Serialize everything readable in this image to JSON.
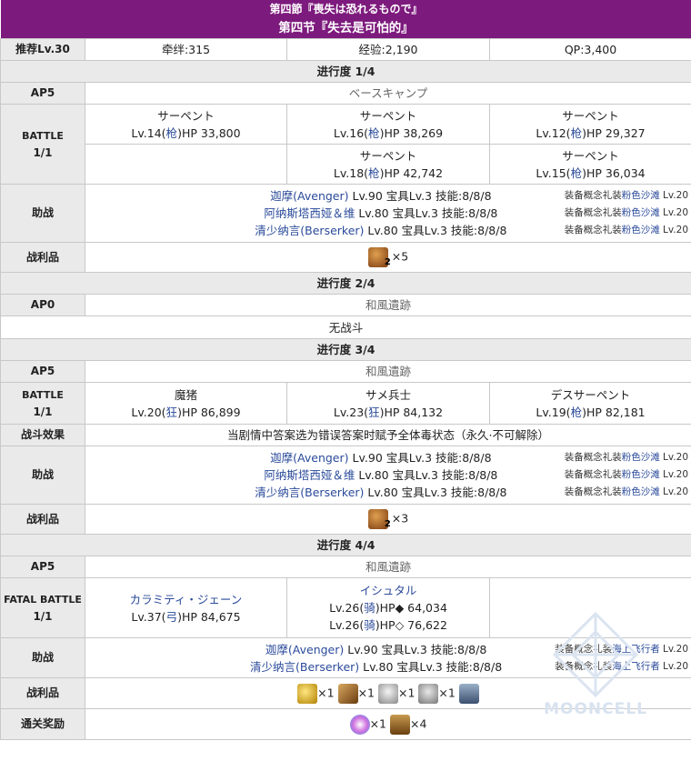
{
  "header": {
    "title_jp": "第四節『喪失は恐れるもので』",
    "title_cn": "第四节『失去是可怕的』"
  },
  "summary": {
    "recommend_label": "推荐Lv.30",
    "bond": "牵绊:315",
    "exp": "经验:2,190",
    "qp": "QP:3,400"
  },
  "progress1": {
    "title": "进行度 1/4",
    "ap": "AP5",
    "location": "ベースキャンプ",
    "battle_label": "BATTLE",
    "battle_count": "1/1",
    "enemies": [
      {
        "name": "サーペント",
        "pre": "Lv.14(",
        "cls": "枪",
        "post": ")HP 33,800"
      },
      {
        "name": "サーペント",
        "pre": "Lv.16(",
        "cls": "枪",
        "post": ")HP 38,269"
      },
      {
        "name": "サーペント",
        "pre": "Lv.12(",
        "cls": "枪",
        "post": ")HP 29,327"
      },
      {
        "name": "サーペント",
        "pre": "Lv.18(",
        "cls": "枪",
        "post": ")HP 42,742"
      },
      {
        "name": "サーペント",
        "pre": "Lv.15(",
        "cls": "枪",
        "post": ")HP 36,034"
      }
    ],
    "support_label": "助战",
    "supports": [
      {
        "name": "迦摩(Avenger)",
        "rest": " Lv.90 宝具Lv.3 技能:8/8/8",
        "ce_pre": "装备概念礼装",
        "ce": "粉色沙滩",
        "ce_lv": " Lv.20"
      },
      {
        "name": "阿纳斯塔西娅＆维",
        "rest": " Lv.80 宝具Lv.3 技能:8/8/8",
        "ce_pre": "装备概念礼装",
        "ce": "粉色沙滩",
        "ce_lv": " Lv.20"
      },
      {
        "name": "清少纳言(Berserker)",
        "rest": " Lv.80 宝具Lv.3 技能:8/8/8",
        "ce_pre": "装备概念礼装",
        "ce": "粉色沙滩",
        "ce_lv": " Lv.20"
      }
    ],
    "drops_label": "战利品",
    "drop_icon": "barrel-icon",
    "drop_sub": "2",
    "drop_count": "×5"
  },
  "progress2": {
    "title": "进行度 2/4",
    "ap": "AP0",
    "location": "和風遺跡",
    "no_battle": "无战斗"
  },
  "progress3": {
    "title": "进行度 3/4",
    "ap": "AP5",
    "location": "和風遺跡",
    "battle_label": "BATTLE",
    "battle_count": "1/1",
    "enemies": [
      {
        "name": "魔猪",
        "pre": "Lv.20(",
        "cls": "狂",
        "post": ")HP 86,899"
      },
      {
        "name": "サメ兵士",
        "pre": "Lv.23(",
        "cls": "狂",
        "post": ")HP 84,132"
      },
      {
        "name": "デスサーペント",
        "pre": "Lv.19(",
        "cls": "枪",
        "post": ")HP 82,181"
      }
    ],
    "effect_label": "战斗效果",
    "effect_text": "当剧情中答案选为错误答案时赋予全体毒状态（永久·不可解除）",
    "support_label": "助战",
    "supports": [
      {
        "name": "迦摩(Avenger)",
        "rest": " Lv.90 宝具Lv.3 技能:8/8/8",
        "ce_pre": "装备概念礼装",
        "ce": "粉色沙滩",
        "ce_lv": " Lv.20"
      },
      {
        "name": "阿纳斯塔西娅＆维",
        "rest": " Lv.80 宝具Lv.3 技能:8/8/8",
        "ce_pre": "装备概念礼装",
        "ce": "粉色沙滩",
        "ce_lv": " Lv.20"
      },
      {
        "name": "清少纳言(Berserker)",
        "rest": " Lv.80 宝具Lv.3 技能:8/8/8",
        "ce_pre": "装备概念礼装",
        "ce": "粉色沙滩",
        "ce_lv": " Lv.20"
      }
    ],
    "drops_label": "战利品",
    "drop_icon": "barrel-icon",
    "drop_sub": "2",
    "drop_count": "×3"
  },
  "progress4": {
    "title": "进行度 4/4",
    "ap": "AP5",
    "location": "和風遺跡",
    "battle_label": "FATAL BATTLE",
    "battle_count": "1/1",
    "enemy1": {
      "name": "カラミティ・ジェーン",
      "pre": "Lv.37(",
      "cls": "弓",
      "post": ")HP 84,675"
    },
    "enemy2": {
      "name": "イシュタル",
      "line1_pre": "Lv.26(",
      "line1_cls": "骑",
      "line1_post": ")HP◆ 64,034",
      "line2_pre": "Lv.26(",
      "line2_cls": "骑",
      "line2_post": ")HP◇ 76,622"
    },
    "support_label": "助战",
    "supports": [
      {
        "name": "迦摩(Avenger)",
        "rest": " Lv.90 宝具Lv.3 技能:8/8/8",
        "ce_pre": "装备概念礼装",
        "ce": "海上飞行者",
        "ce_lv": " Lv.20"
      },
      {
        "name": "清少纳言(Berserker)",
        "rest": " Lv.80 宝具Lv.3 技能:8/8/8",
        "ce_pre": "装备概念礼装",
        "ce": "海上飞行者",
        "ce_lv": " Lv.20"
      }
    ],
    "drops_label": "战利品",
    "drops": [
      {
        "icon": "gold-trophy-icon",
        "count": "×1"
      },
      {
        "icon": "wooden-horn-icon",
        "count": "×1"
      },
      {
        "icon": "white-statue-icon",
        "count": "×1"
      },
      {
        "icon": "gray-statue-icon",
        "count": "×1"
      },
      {
        "icon": "treasure-chest-icon",
        "count": ""
      }
    ],
    "reward_label": "通关奖励",
    "rewards": [
      {
        "icon": "saint-quartz-icon",
        "count": "×1"
      },
      {
        "icon": "bronze-chest-icon",
        "count": "×4"
      }
    ]
  },
  "watermark": "MOONCELL"
}
